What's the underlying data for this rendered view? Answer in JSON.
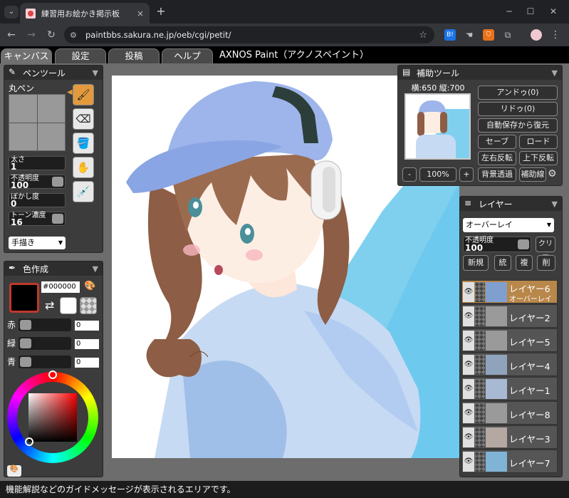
{
  "browser": {
    "tab_title": "練習用お絵かき掲示板",
    "url": "paintbbs.sakura.ne.jp/oeb/cgi/petit/",
    "new_tab": "+",
    "tab_close": "×",
    "tab_menu": "⌄",
    "ext_b": "B!",
    "ext_shield": "⛉"
  },
  "menu": {
    "tabs": [
      "キャンバス",
      "設定",
      "投稿",
      "ヘルプ"
    ],
    "app_title": "AXNOS Paint（アクノスペイント）"
  },
  "pen_panel": {
    "title": "ペンツール",
    "brush_name": "丸ペン",
    "sliders": [
      {
        "label": "太さ",
        "value": "1",
        "level": 0.0
      },
      {
        "label": "不透明度",
        "value": "100",
        "level": 1.0
      },
      {
        "label": "ぼかし度",
        "value": "0",
        "level": 0.0
      },
      {
        "label": "トーン濃度",
        "value": "16",
        "level": 1.0
      }
    ],
    "mode_select": "手描き",
    "tools": [
      "pen-icon",
      "eraser-icon",
      "bucket-icon",
      "hand-icon",
      "eyedropper-icon"
    ]
  },
  "color_panel": {
    "title": "色作成",
    "hex": "#000000",
    "primary": "#000000",
    "secondary": "#ffffff",
    "channels": [
      {
        "label": "赤",
        "value": "0"
      },
      {
        "label": "緑",
        "value": "0"
      },
      {
        "label": "青",
        "value": "0"
      }
    ]
  },
  "aux_panel": {
    "title": "補助ツール",
    "size_text": "横:650 縦:700",
    "undo": "アンドゥ(0)",
    "redo": "リドゥ(0)",
    "restore": "自動保存から復元",
    "save": "セーブ",
    "load": "ロード",
    "flip_h": "左右反転",
    "flip_v": "上下反転",
    "transparent_bg": "背景透過",
    "guide": "補助線",
    "zoom_minus": "-",
    "zoom": "100%",
    "zoom_plus": "+"
  },
  "layer_panel": {
    "title": "レイヤー",
    "blend_mode": "オーバーレイ",
    "opacity_label": "不透明度",
    "opacity_value": "100",
    "clear": "クリア",
    "new": "新規",
    "merge": "統",
    "dup": "複",
    "delete": "削",
    "layers": [
      {
        "name": "レイヤー6",
        "sub": "オーバーレイ",
        "active": true
      },
      {
        "name": "レイヤー2",
        "sub": "",
        "active": false
      },
      {
        "name": "レイヤー5",
        "sub": "",
        "active": false
      },
      {
        "name": "レイヤー4",
        "sub": "",
        "active": false
      },
      {
        "name": "レイヤー1",
        "sub": "",
        "active": false
      },
      {
        "name": "レイヤー8",
        "sub": "",
        "active": false
      },
      {
        "name": "レイヤー3",
        "sub": "",
        "active": false
      },
      {
        "name": "レイヤー7",
        "sub": "",
        "active": false
      }
    ]
  },
  "status": "機能解説などのガイドメッセージが表示されるエリアです。"
}
